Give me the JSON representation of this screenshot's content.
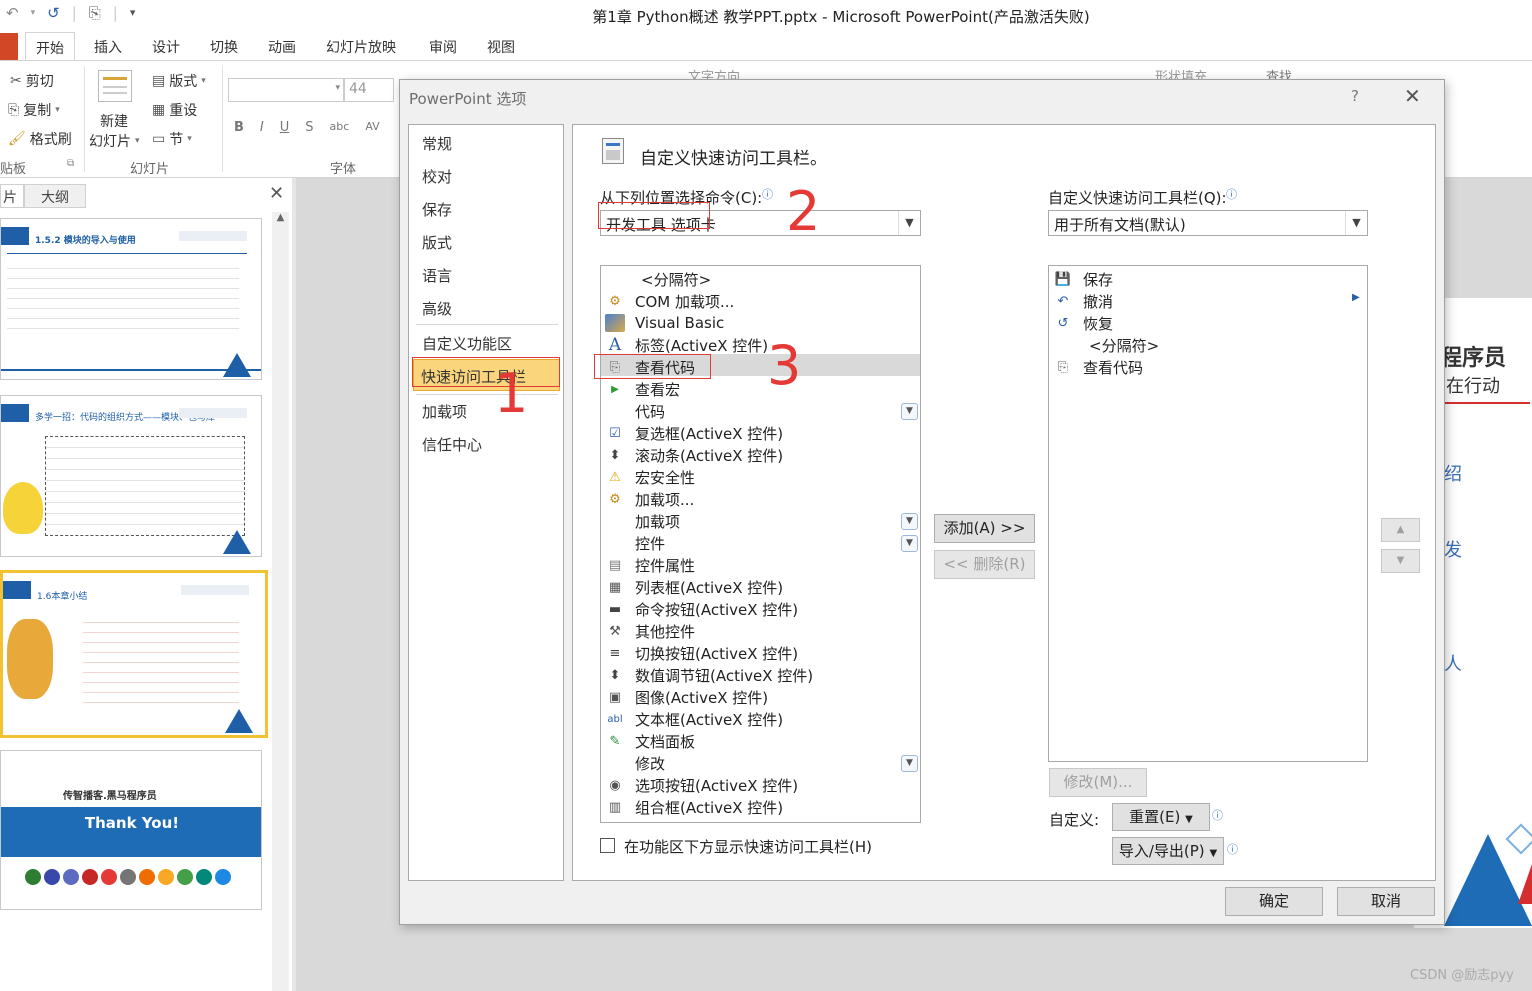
{
  "window": {
    "title": "第1章 Python概述 教学PPT.pptx - Microsoft PowerPoint(产品激活失败)"
  },
  "ribbon": {
    "tabs": [
      "开始",
      "插入",
      "设计",
      "切换",
      "动画",
      "幻灯片放映",
      "审阅",
      "视图"
    ],
    "clipboard": {
      "cut": "剪切",
      "copy": "复制",
      "format_painter": "格式刷",
      "group": "贴板"
    },
    "slides": {
      "new_slide_1": "新建",
      "new_slide_2": "幻灯片",
      "layout": "版式",
      "reset": "重设",
      "section": "节",
      "group": "幻灯片"
    },
    "font": {
      "size": "44",
      "group": "字体"
    },
    "background_hint": {
      "text_dir": "文字方向",
      "shape_fill": "形状填充",
      "find": "查找"
    }
  },
  "left_panel": {
    "tab_slides": "片",
    "tab_outline": "大纲",
    "slide1": {
      "title": "1.5.2 模块的导入与使用"
    },
    "slide2": {
      "title": "多学一招：代码的组织方式——模块、包与库"
    },
    "slide3": {
      "title": "1.6本章小结"
    },
    "slide4": {
      "brand": "传智播客.黑马程序员",
      "thanks": "Thank You!"
    }
  },
  "slide_right": {
    "t1": "程序员",
    "t2": "在行动",
    "t3": "绍",
    "t4": "发",
    "t5": "人"
  },
  "dialog": {
    "title": "PowerPoint 选项",
    "help": "?",
    "nav": {
      "general": "常规",
      "proofing": "校对",
      "save": "保存",
      "layout": "版式",
      "language": "语言",
      "advanced": "高级",
      "customize_ribbon": "自定义功能区",
      "qat": "快速访问工具栏",
      "addins": "加载项",
      "trust_center": "信任中心"
    },
    "heading": "自定义快速访问工具栏。",
    "choose_label": "从下列位置选择命令(C):",
    "choose_value": "开发工具 选项卡",
    "customize_label": "自定义快速访问工具栏(Q):",
    "customize_value": "用于所有文档(默认)",
    "commands": [
      {
        "icon": "",
        "label": "<分隔符>"
      },
      {
        "icon": "com-addins-icon",
        "label": "COM 加载项..."
      },
      {
        "icon": "visual-basic-icon",
        "label": "Visual Basic"
      },
      {
        "icon": "label-control-icon",
        "label": "标签(ActiveX 控件)"
      },
      {
        "icon": "view-code-icon",
        "label": "查看代码"
      },
      {
        "icon": "macro-play-icon",
        "label": "查看宏"
      },
      {
        "icon": "",
        "label": "代码"
      },
      {
        "icon": "checkbox-control-icon",
        "label": "复选框(ActiveX 控件)"
      },
      {
        "icon": "scrollbar-control-icon",
        "label": "滚动条(ActiveX 控件)"
      },
      {
        "icon": "macro-security-icon",
        "label": "宏安全性"
      },
      {
        "icon": "addins-icon",
        "label": "加载项..."
      },
      {
        "icon": "",
        "label": "加载项"
      },
      {
        "icon": "",
        "label": "控件"
      },
      {
        "icon": "control-properties-icon",
        "label": "控件属性"
      },
      {
        "icon": "listbox-control-icon",
        "label": "列表框(ActiveX 控件)"
      },
      {
        "icon": "command-button-icon",
        "label": "命令按钮(ActiveX 控件)"
      },
      {
        "icon": "more-controls-icon",
        "label": "其他控件"
      },
      {
        "icon": "toggle-button-icon",
        "label": "切换按钮(ActiveX 控件)"
      },
      {
        "icon": "spin-button-icon",
        "label": "数值调节钮(ActiveX 控件)"
      },
      {
        "icon": "image-control-icon",
        "label": "图像(ActiveX 控件)"
      },
      {
        "icon": "textbox-control-icon",
        "label": "文本框(ActiveX 控件)"
      },
      {
        "icon": "document-panel-icon",
        "label": "文档面板"
      },
      {
        "icon": "",
        "label": "修改"
      },
      {
        "icon": "option-button-icon",
        "label": "选项按钮(ActiveX 控件)"
      },
      {
        "icon": "combobox-control-icon",
        "label": "组合框(ActiveX 控件)"
      }
    ],
    "qat_items": [
      {
        "icon": "save-icon",
        "label": "保存"
      },
      {
        "icon": "undo-icon",
        "label": "撤消"
      },
      {
        "icon": "redo-icon",
        "label": "恢复"
      },
      {
        "icon": "",
        "label": "<分隔符>"
      },
      {
        "icon": "view-code-icon",
        "label": "查看代码"
      }
    ],
    "add_button": "添加(A) >>",
    "remove_button": "<< 删除(R)",
    "modify_button": "修改(M)...",
    "customize_label2": "自定义:",
    "reset_button": "重置(E)",
    "import_export_button": "导入/导出(P)",
    "show_below_label": "在功能区下方显示快速访问工具栏(H)",
    "ok": "确定",
    "cancel": "取消"
  },
  "annotations": {
    "n1": "1",
    "n2": "2",
    "n3": "3"
  },
  "watermark": "CSDN @励志pyy"
}
